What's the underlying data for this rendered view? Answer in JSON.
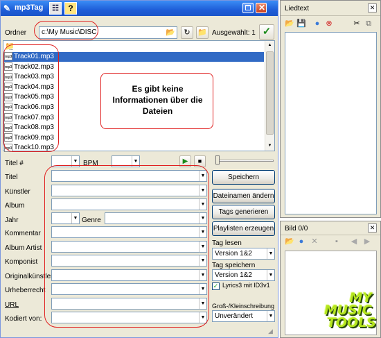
{
  "main_window": {
    "title": "mp3Tag",
    "folder_label": "Ordner",
    "folder_path": "c:\\My Music\\DISC",
    "selected_label": "Ausgewählt: 1",
    "parent_dir": "..",
    "files": [
      "Track01.mp3",
      "Track02.mp3",
      "Track03.mp3",
      "Track04.mp3",
      "Track05.mp3",
      "Track06.mp3",
      "Track07.mp3",
      "Track08.mp3",
      "Track09.mp3",
      "Track10.mp3"
    ],
    "info_message": "Es gibt keine Informationen über die Dateien",
    "fields": {
      "track": "Titel #",
      "bpm": "BPM",
      "title": "Titel",
      "artist": "Künstler",
      "album": "Album",
      "year": "Jahr",
      "genre": "Genre",
      "comment": "Kommentar",
      "album_artist": "Album Artist",
      "composer": "Komponist",
      "original_artist": "Originalkünstler",
      "copyright": "Urheberrecht",
      "url": "URL",
      "encoded_by": "Kodiert von:"
    },
    "buttons": {
      "save": "Speichern",
      "rename": "Dateinamen ändern",
      "generate": "Tags generieren",
      "playlists": "Playlisten erzeugen"
    },
    "tag_read_label": "Tag lesen",
    "tag_read_value": "Version 1&2",
    "tag_save_label": "Tag speichern",
    "tag_save_value": "Version 1&2",
    "lyrics_checkbox": "Lyrics3 mit ID3v1",
    "case_label": "Groß-/Kleinschreibung",
    "case_value": "Unverändert"
  },
  "lyrics_panel": {
    "title": "Liedtext"
  },
  "image_panel": {
    "title": "Bild 0/0"
  },
  "logo": {
    "line1": "MY",
    "line2": "MUSIC",
    "line3": "TOOLS"
  },
  "colors": {
    "selection": "#316ac5",
    "annotation": "#e02020",
    "titlebar": "#1f5ed8"
  }
}
